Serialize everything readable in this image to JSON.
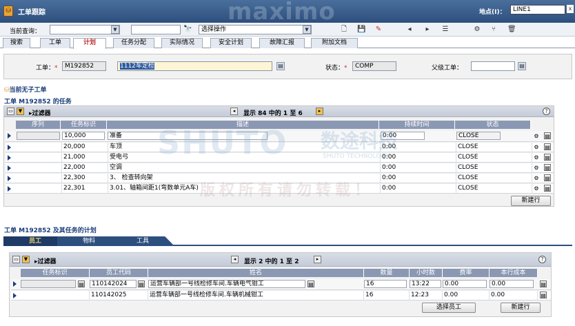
{
  "app": {
    "title": "工单跟踪",
    "brand": "maximo",
    "site_label": "地点(I)：",
    "site_value": "LINE1",
    "close": "x"
  },
  "toolbar": {
    "query_label": "当前查询：",
    "query_value": "",
    "search_value": "",
    "action_select": "选择操作",
    "search_glyph": "🔭"
  },
  "tabs": [
    "搜索",
    "工单",
    "计划",
    "任务分配",
    "实际情况",
    "安全计划",
    "故障汇报",
    "附加文档"
  ],
  "header": {
    "wo_label": "工单：",
    "wo_value": "M192852",
    "desc_value": "1112车定检",
    "status_label": "状态：",
    "status_value": "COMP",
    "parent_label": "父级工单：",
    "parent_value": ""
  },
  "no_children": "当前无子工单",
  "tasks_title": "工单 M192852 的任务",
  "tasks": {
    "filter": "过滤器",
    "paging": "显示 84 中的 1 至 6",
    "columns": [
      "序列",
      "任务标识",
      "描述",
      "持续时间",
      "状态"
    ],
    "rows": [
      {
        "seq": "",
        "task": "10,000",
        "desc": "准备",
        "dur": "0:00",
        "status": "CLOSE"
      },
      {
        "seq": "",
        "task": "20,000",
        "desc": "车顶",
        "dur": "0:00",
        "status": "CLOSE"
      },
      {
        "seq": "",
        "task": "21,000",
        "desc": "受电弓",
        "dur": "0:00",
        "status": "CLOSE"
      },
      {
        "seq": "",
        "task": "22,000",
        "desc": "空调",
        "dur": "0:00",
        "status": "CLOSE"
      },
      {
        "seq": "",
        "task": "22,300",
        "desc": "3、 检查转向架",
        "dur": "0:00",
        "status": "CLOSE"
      },
      {
        "seq": "",
        "task": "22,301",
        "desc": "3.01、轴箱间距1(弯数单元A车)",
        "dur": "0:00",
        "status": "CLOSE"
      }
    ],
    "new_row": "新建行"
  },
  "plan_title": "工单 M192852 及其任务的计划",
  "subtabs": [
    "员工",
    "物料",
    "工具"
  ],
  "labor": {
    "filter": "过滤器",
    "paging": "显示 2 中的 1 至 2",
    "columns": [
      "任务标识",
      "员工代码",
      "姓名",
      "数量",
      "小时数",
      "费率",
      "本行成本"
    ],
    "rows": [
      {
        "task": "",
        "code": "110142024",
        "name": "运营车辆部一号线检修车间.车辆电气钳工",
        "qty": "16",
        "hrs": "13:22",
        "rate": "0.00",
        "cost": "0.00"
      },
      {
        "task": "",
        "code": "110142025",
        "name": "运营车辆部一号线检修车间.车辆机械钳工",
        "qty": "16",
        "hrs": "12:23",
        "rate": "0.00",
        "cost": "0.00"
      }
    ],
    "select_btn": "选择员工",
    "new_row": "新建行"
  },
  "watermark": {
    "logo": "SHUTO",
    "cn": "数途科技",
    "en": "SHUTO TECHNOLOGY",
    "notice": "版权所有请勿转载！"
  }
}
